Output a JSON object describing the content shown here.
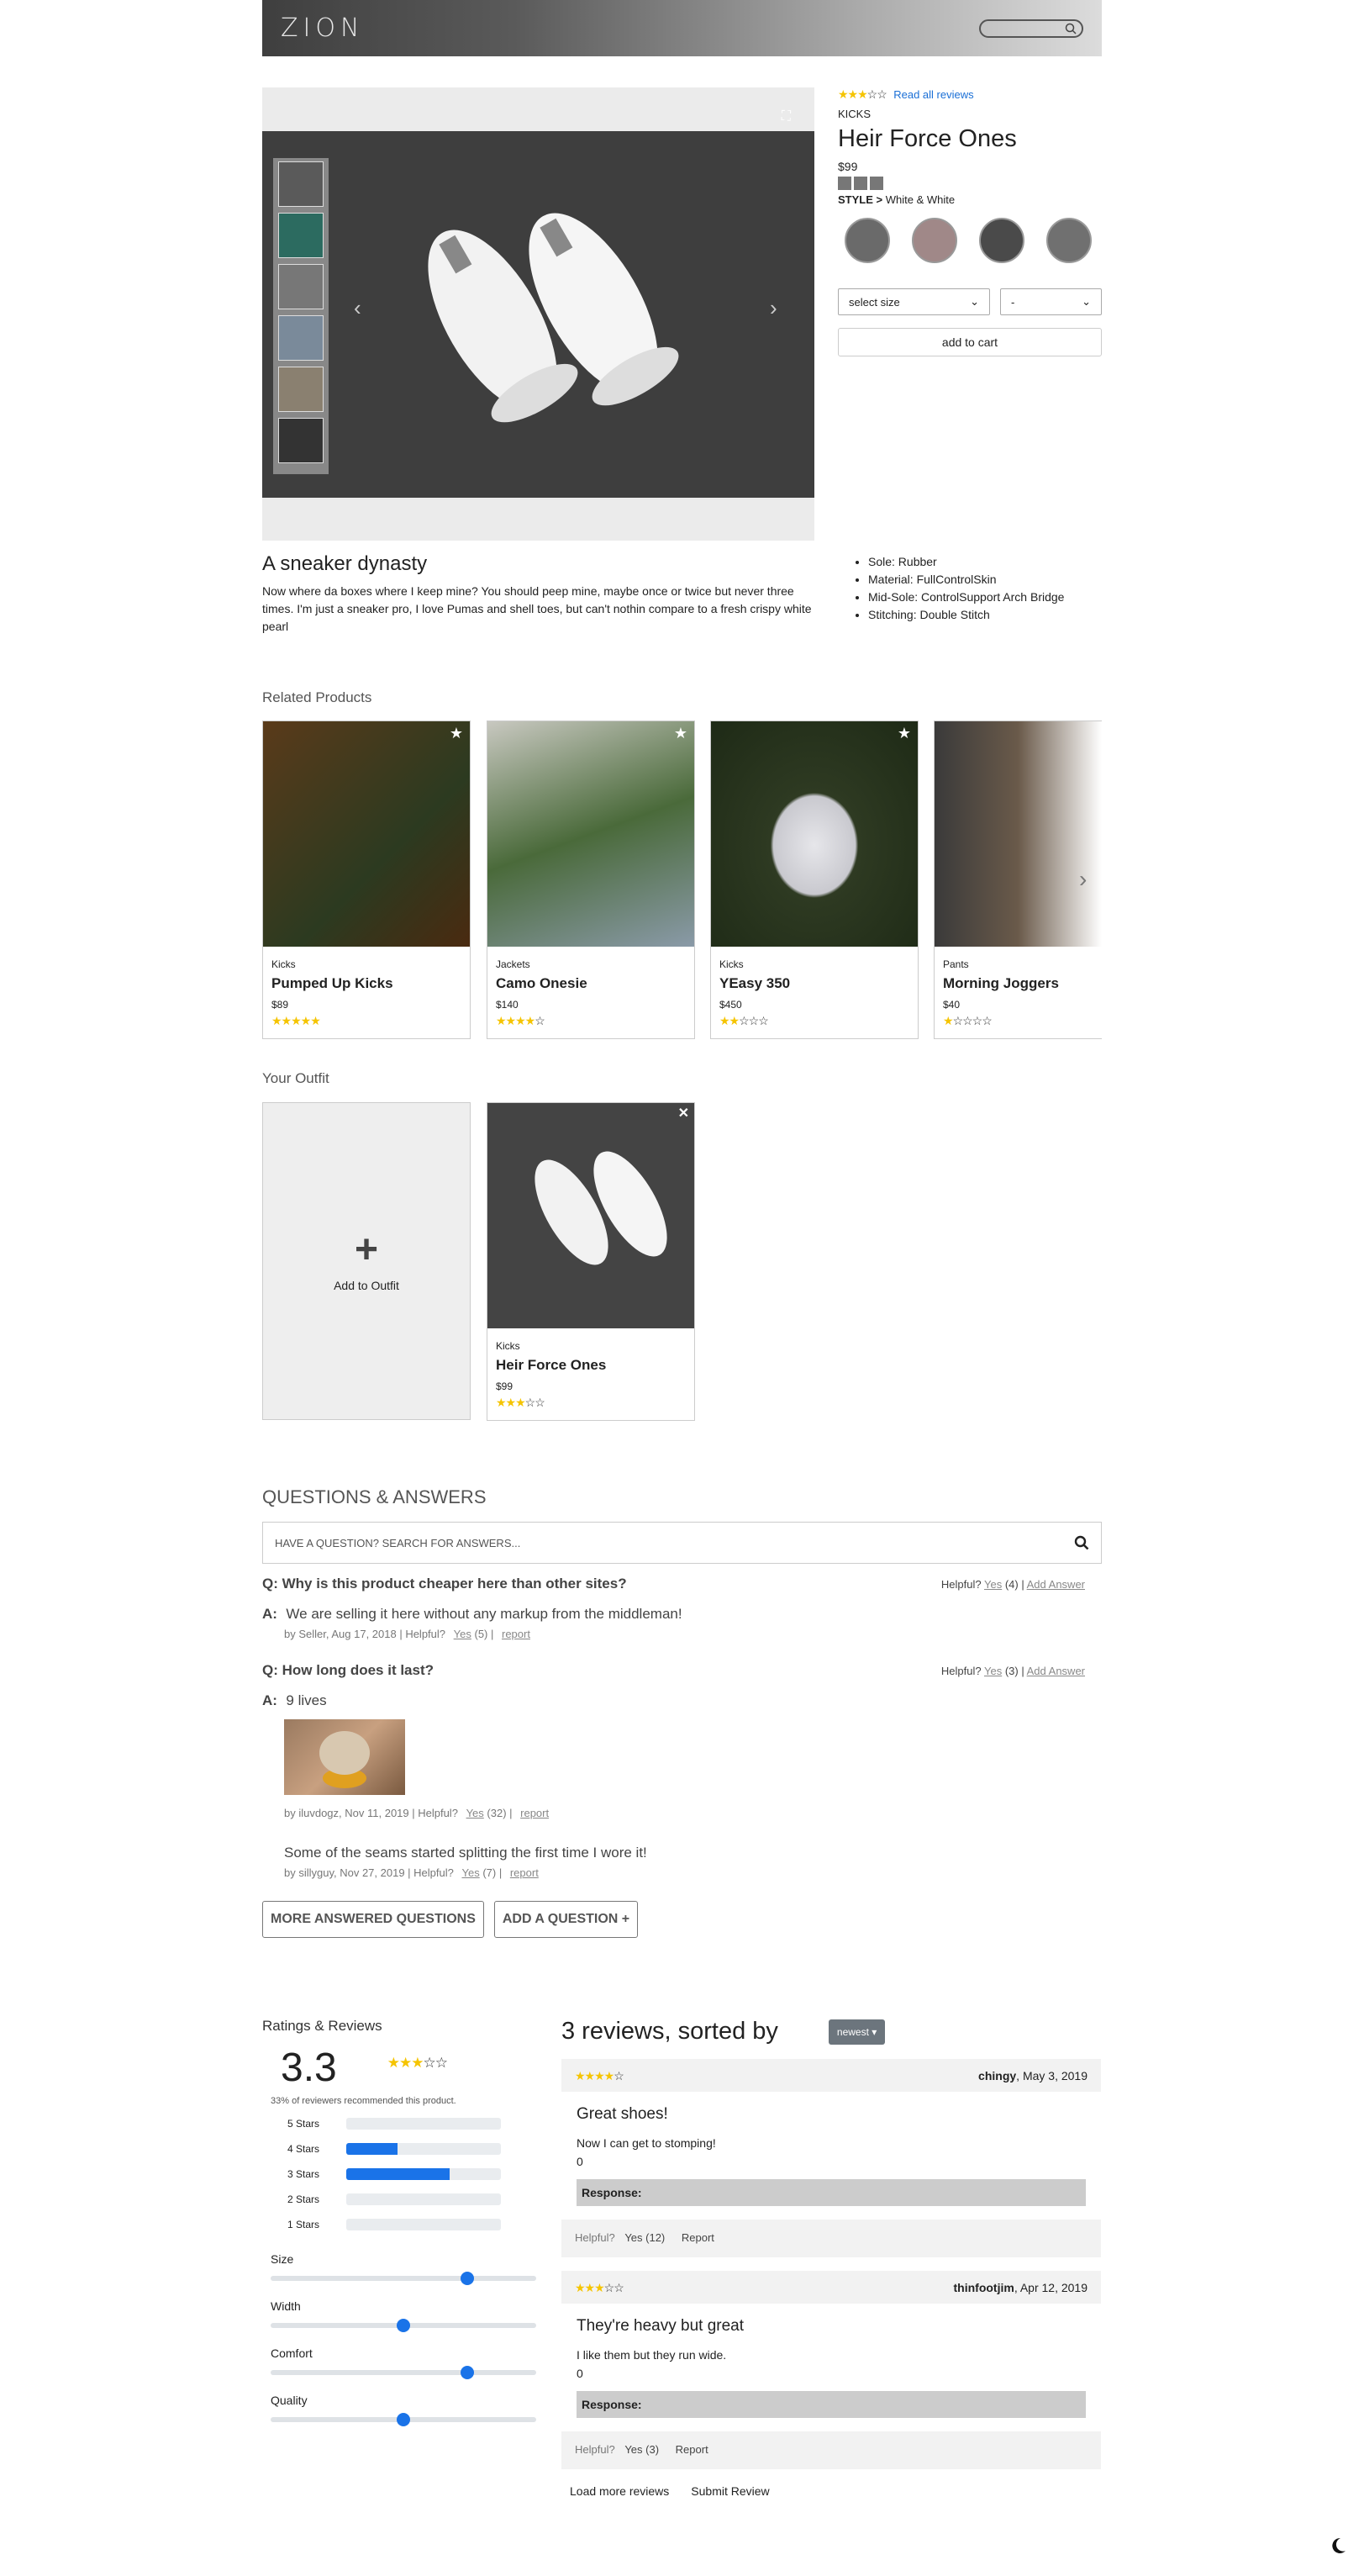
{
  "header": {
    "logo": "ZION"
  },
  "product": {
    "rating": 3,
    "read_reviews": "Read all reviews",
    "category": "KICKS",
    "title": "Heir Force Ones",
    "price": "$99",
    "style_label": "STYLE >",
    "style_value": "White & White",
    "size_placeholder": "select size",
    "qty_placeholder": "-",
    "add_to_cart": "add to cart",
    "description_title": "A sneaker dynasty",
    "description": "Now where da boxes where I keep mine? You should peep mine, maybe once or twice but never three times. I'm just a sneaker pro, I love Pumas and shell toes, but can't nothin compare to a fresh crispy white pearl",
    "features": [
      "Sole: Rubber",
      "Material: FullControlSkin",
      "Mid-Sole: ControlSupport Arch Bridge",
      "Stitching: Double Stitch"
    ]
  },
  "related": {
    "title": "Related Products",
    "items": [
      {
        "category": "Kicks",
        "name": "Pumped Up Kicks",
        "price": "$89",
        "rating": 5
      },
      {
        "category": "Jackets",
        "name": "Camo Onesie",
        "price": "$140",
        "rating": 4
      },
      {
        "category": "Kicks",
        "name": "YEasy 350",
        "price": "$450",
        "rating": 2
      },
      {
        "category": "Pants",
        "name": "Morning Joggers",
        "price": "$40",
        "rating": 1
      }
    ]
  },
  "outfit": {
    "title": "Your Outfit",
    "add_label": "Add to Outfit",
    "item": {
      "category": "Kicks",
      "name": "Heir Force Ones",
      "price": "$99",
      "rating": 3
    }
  },
  "qa": {
    "title": "QUESTIONS & ANSWERS",
    "search_placeholder": "HAVE A QUESTION? SEARCH FOR ANSWERS...",
    "q1": {
      "text": "Q: Why is this product cheaper here than other sites?",
      "helpful": "Helpful?",
      "yes": "Yes",
      "count": "(4) |",
      "add_answer": "Add Answer",
      "a_prefix": "A:",
      "answer": "We are selling it here without any markup from the middleman!",
      "meta": "by Seller, Aug 17, 2018 | Helpful?",
      "a_yes": "Yes",
      "a_count": "(5) |",
      "report": "report"
    },
    "q2": {
      "text": "Q: How long does it last?",
      "helpful": "Helpful?",
      "yes": "Yes",
      "count": "(3) |",
      "add_answer": "Add Answer",
      "a_prefix": "A:",
      "answer": "9 lives",
      "meta": "by iluvdogz, Nov 11, 2019 | Helpful?",
      "a_yes": "Yes",
      "a_count": "(32) |",
      "report": "report",
      "answer2": "Some of the seams started splitting the first time I wore it!",
      "meta2": "by sillyguy, Nov 27, 2019 | Helpful?",
      "a2_yes": "Yes",
      "a2_count": "(7) |",
      "report2": "report"
    },
    "more_btn": "MORE ANSWERED QUESTIONS",
    "add_btn": "ADD A QUESTION +"
  },
  "ratings": {
    "title": "Ratings & Reviews",
    "average": "3.3",
    "average_stars": 3,
    "recommend": "33% of reviewers recommended this product.",
    "breakdown": [
      {
        "label": "5 Stars",
        "fraction": 0
      },
      {
        "label": "4 Stars",
        "fraction": 0.33
      },
      {
        "label": "3 Stars",
        "fraction": 0.67
      },
      {
        "label": "2 Stars",
        "fraction": 0
      },
      {
        "label": "1 Stars",
        "fraction": 0
      }
    ],
    "characteristics": [
      {
        "label": "Size",
        "value": 0.74
      },
      {
        "label": "Width",
        "value": 0.5
      },
      {
        "label": "Comfort",
        "value": 0.74
      },
      {
        "label": "Quality",
        "value": 0.5
      }
    ]
  },
  "reviews": {
    "heading": "3 reviews, sorted by",
    "sort": "newest",
    "list": [
      {
        "rating": 4,
        "user": "chingy",
        "date": ", May 3, 2019",
        "summary": "Great shoes!",
        "body": "Now I can get to stomping!",
        "extra": "0",
        "response": "Response:",
        "helpful": "Helpful?",
        "yes": "Yes (12)",
        "report": "Report"
      },
      {
        "rating": 3,
        "user": "thinfootjim",
        "date": ", Apr 12, 2019",
        "summary": "They're heavy but great",
        "body": "I like them but they run wide.",
        "extra": "0",
        "response": "Response:",
        "helpful": "Helpful?",
        "yes": "Yes (3)",
        "report": "Report"
      }
    ],
    "load_more": "Load more reviews",
    "submit": "Submit Review"
  }
}
